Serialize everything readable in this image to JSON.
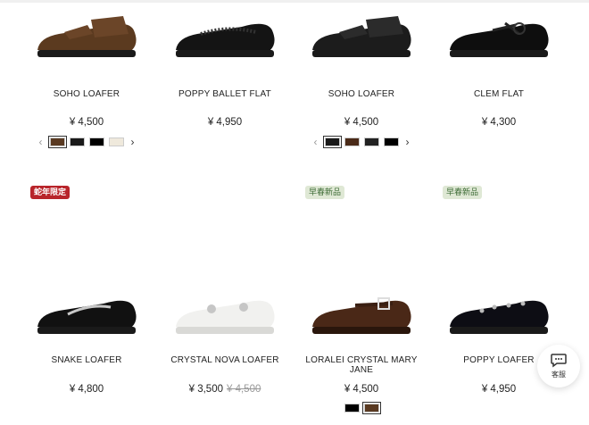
{
  "products": [
    {
      "name": "SOHO LOAFER",
      "price": "¥ 4,500",
      "swatches": [
        "#5a3a22",
        "#1a1a1a",
        "#000000",
        "#efe9dc"
      ],
      "selected_swatch": 0,
      "has_arrows": true,
      "shoe_color": "brown-loafer"
    },
    {
      "name": "POPPY BALLET FLAT",
      "price": "¥ 4,950",
      "swatches": [],
      "has_arrows": false,
      "shoe_color": "black-flat"
    },
    {
      "name": "SOHO LOAFER",
      "price": "¥ 4,500",
      "swatches": [
        "#1a1a1a",
        "#4a2a18",
        "#222222",
        "#000000"
      ],
      "selected_swatch": 0,
      "has_arrows": true,
      "shoe_color": "black-loafer"
    },
    {
      "name": "CLEM FLAT",
      "price": "¥ 4,300",
      "swatches": [],
      "has_arrows": false,
      "shoe_color": "black-mary"
    },
    {
      "name": "SNAKE LOAFER",
      "price": "¥ 4,800",
      "badge": "蛇年限定",
      "badge_style": "red",
      "swatches": [],
      "has_arrows": false,
      "shoe_color": "snake-loafer"
    },
    {
      "name": "CRYSTAL NOVA LOAFER",
      "price": "¥ 3,500",
      "original_price": "¥ 4,500",
      "swatches": [],
      "has_arrows": false,
      "shoe_color": "white-loafer"
    },
    {
      "name": "LORALEI CRYSTAL MARY JANE",
      "price": "¥ 4,500",
      "badge": "早春新品",
      "badge_style": "green",
      "swatches": [
        "#000000",
        "#5a3a22"
      ],
      "selected_swatch": 1,
      "has_arrows": false,
      "shoe_color": "brown-mary"
    },
    {
      "name": "POPPY LOAFER",
      "price": "¥ 4,950",
      "badge": "早春新品",
      "badge_style": "green",
      "swatches": [],
      "has_arrows": false,
      "shoe_color": "velvet-loafer"
    }
  ],
  "chat": {
    "label": "客服",
    "icon": "chat-bubble-icon"
  }
}
